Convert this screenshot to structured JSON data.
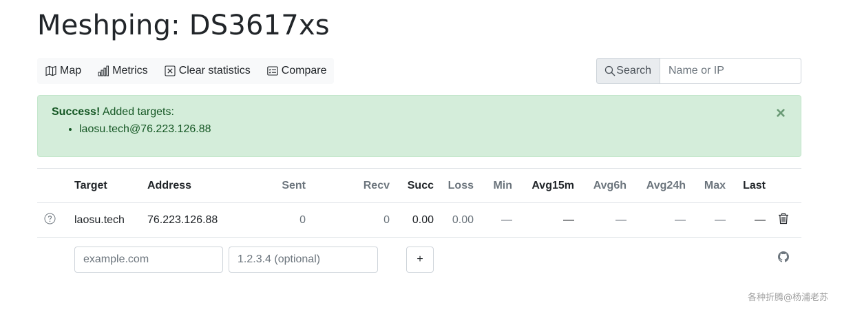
{
  "page": {
    "title": "Meshping: DS3617xs"
  },
  "toolbar": {
    "map_label": "Map",
    "metrics_label": "Metrics",
    "clear_label": "Clear statistics",
    "compare_label": "Compare"
  },
  "search": {
    "button_label": "Search",
    "placeholder": "Name or IP"
  },
  "alert": {
    "strong": "Success!",
    "message": "Added targets:",
    "items": [
      "laosu.tech@76.223.126.88"
    ],
    "close_symbol": "×"
  },
  "table": {
    "headers": {
      "target": "Target",
      "address": "Address",
      "sent": "Sent",
      "recv": "Recv",
      "succ": "Succ",
      "loss": "Loss",
      "min": "Min",
      "avg15m": "Avg15m",
      "avg6h": "Avg6h",
      "avg24h": "Avg24h",
      "max": "Max",
      "last": "Last"
    },
    "rows": [
      {
        "target": "laosu.tech",
        "address": "76.223.126.88",
        "sent": "0",
        "recv": "0",
        "succ": "0.00",
        "loss": "0.00",
        "min": "—",
        "avg15m": "—",
        "avg6h": "—",
        "avg24h": "—",
        "max": "—",
        "last": "—"
      }
    ],
    "add": {
      "name_placeholder": "example.com",
      "address_placeholder": "1.2.3.4 (optional)",
      "add_label": "+"
    }
  },
  "watermark": "各种折腾@杨浦老苏"
}
